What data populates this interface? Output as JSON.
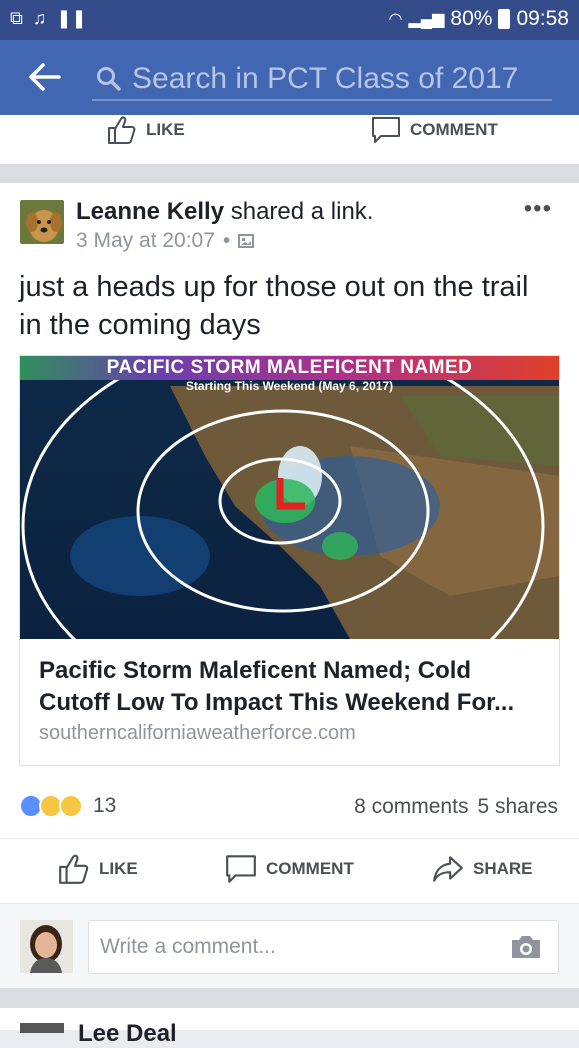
{
  "status_bar": {
    "battery": "80%",
    "time": "09:58",
    "icons": [
      "usb-icon",
      "media-icon",
      "pause-icon",
      "wifi-icon",
      "signal-icon",
      "battery-icon"
    ]
  },
  "search_bar": {
    "placeholder": "Search in PCT Class of 2017"
  },
  "previous_post_actions": {
    "like_label": "LIKE",
    "comment_label": "COMMENT"
  },
  "post": {
    "author": "Leanne Kelly",
    "action_text": " shared a link.",
    "date": "3 May at 20:07",
    "separator": "•",
    "more": "•••",
    "text": "just a heads up for those out on the trail in the coming days",
    "link": {
      "image_title": "PACIFIC STORM MALEFICENT NAMED",
      "image_subtitle": "Starting This Weekend (May 6, 2017)",
      "title": "Pacific Storm Maleficent Named; Cold Cutoff Low To Impact This Weekend For...",
      "domain": "southerncaliforniaweatherforce.com"
    },
    "reaction_count": "13",
    "comments": "8 comments",
    "shares": "5 shares",
    "actions": {
      "like": "LIKE",
      "comment": "COMMENT",
      "share": "SHARE"
    },
    "comment_placeholder": "Write a comment..."
  },
  "next_post": {
    "author_partial": "Lee Deal"
  },
  "colors": {
    "status_bar": "#344c8a",
    "header": "#4267b2",
    "like_blue": "#5890ff",
    "emoji_yellow": "#f7c744"
  }
}
